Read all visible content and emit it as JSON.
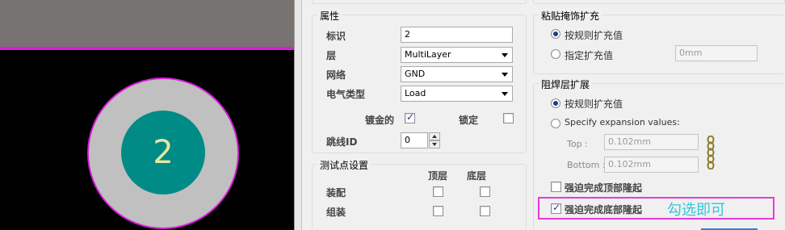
{
  "canvas": {
    "pad_designator": "2",
    "colors": {
      "board": "#000000",
      "pad_copper": "#c0c0c0",
      "pad_hole": "#008b87",
      "outline": "#d61fd6"
    }
  },
  "properties": {
    "group_title": "属性",
    "designator_label": "标识",
    "designator_value": "2",
    "layer_label": "层",
    "layer_value": "MultiLayer",
    "net_label": "网络",
    "net_value": "GND",
    "electrical_type_label": "电气类型",
    "electrical_type_value": "Load",
    "plated_label": "镀金的",
    "plated_checked": true,
    "locked_label": "锁定",
    "locked_checked": false,
    "jumper_id_label": "跳线ID",
    "jumper_id_value": "0"
  },
  "testpoint": {
    "group_title": "测试点设置",
    "top_label": "顶层",
    "bottom_label": "底层",
    "assembly_label": "装配",
    "fab_label": "组装"
  },
  "paste_mask": {
    "group_title": "粘贴掩饰扩充",
    "rule_option": "按规则扩充值",
    "specify_option": "指定扩充值",
    "specify_value": "0mm"
  },
  "solder_mask": {
    "group_title": "阻焊层扩展",
    "rule_option": "按规则扩充值",
    "specify_option": "Specify expansion values:",
    "top_label": "Top :",
    "top_value": "0.102mm",
    "bottom_label": "Bottom :",
    "bottom_value": "0.102mm",
    "force_top_label": "强迫完成顶部隆起",
    "force_top_checked": false,
    "force_bottom_label": "强迫完成底部隆起",
    "force_bottom_checked": true
  },
  "annotation": {
    "text": "勾选即可",
    "color": "#2fc8dc",
    "box_color": "#e63ad6"
  }
}
